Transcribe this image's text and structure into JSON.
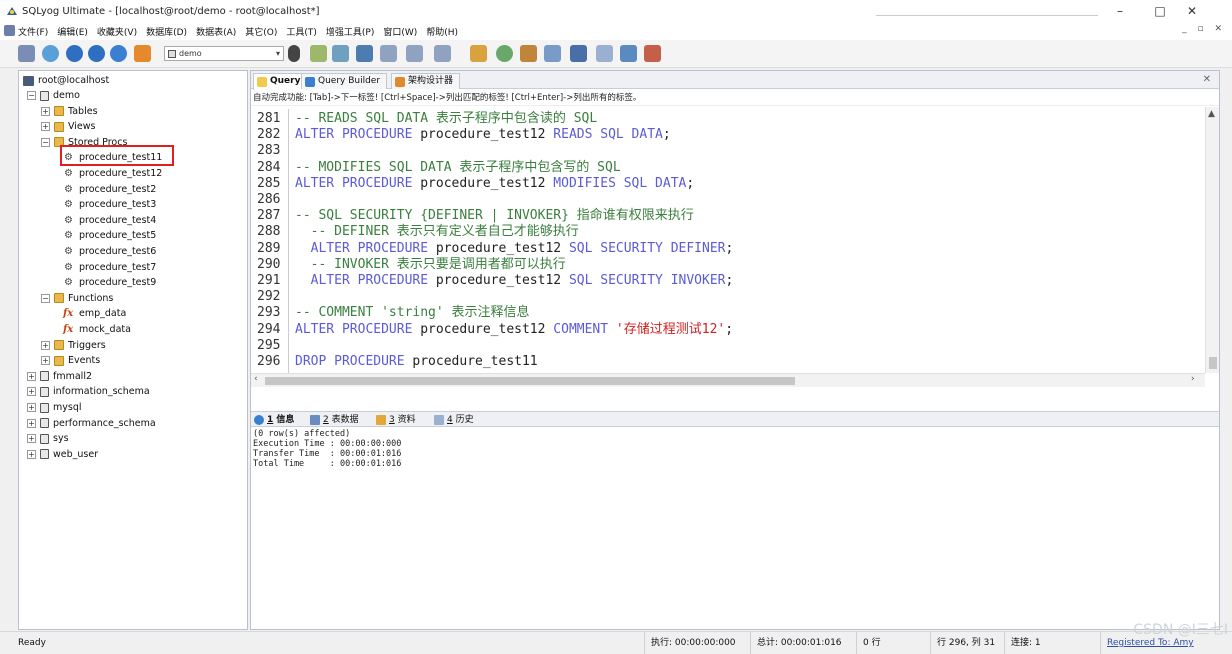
{
  "window": {
    "title": "SQLyog Ultimate - [localhost@root/demo - root@localhost*]",
    "min_glyph": "–",
    "max_glyph": "□",
    "close_glyph": "✕"
  },
  "menu": {
    "items": [
      "文件(F)",
      "编辑(E)",
      "收藏夹(V)",
      "数据库(D)",
      "数据表(A)",
      "其它(O)",
      "工具(T)",
      "增强工具(P)",
      "窗口(W)",
      "帮助(H)"
    ],
    "mdi_controls": "_ ▫ ✕"
  },
  "toolbar": {
    "db_select": "demo"
  },
  "object_browser": {
    "connection": "root@localhost",
    "tree": [
      {
        "level": 0,
        "kind": "db",
        "label": "demo",
        "expanded": true
      },
      {
        "level": 1,
        "kind": "folder",
        "label": "Tables",
        "expanded": false
      },
      {
        "level": 1,
        "kind": "folder",
        "label": "Views",
        "expanded": false
      },
      {
        "level": 1,
        "kind": "folder",
        "label": "Stored Procs",
        "expanded": true
      },
      {
        "level": 2,
        "kind": "proc",
        "label": "procedure_test11",
        "selected": true
      },
      {
        "level": 2,
        "kind": "proc",
        "label": "procedure_test12"
      },
      {
        "level": 2,
        "kind": "proc",
        "label": "procedure_test2"
      },
      {
        "level": 2,
        "kind": "proc",
        "label": "procedure_test3"
      },
      {
        "level": 2,
        "kind": "proc",
        "label": "procedure_test4"
      },
      {
        "level": 2,
        "kind": "proc",
        "label": "procedure_test5"
      },
      {
        "level": 2,
        "kind": "proc",
        "label": "procedure_test6"
      },
      {
        "level": 2,
        "kind": "proc",
        "label": "procedure_test7"
      },
      {
        "level": 2,
        "kind": "proc",
        "label": "procedure_test9"
      },
      {
        "level": 1,
        "kind": "folder",
        "label": "Functions",
        "expanded": true
      },
      {
        "level": 2,
        "kind": "func",
        "label": "emp_data"
      },
      {
        "level": 2,
        "kind": "func",
        "label": "mock_data"
      },
      {
        "level": 1,
        "kind": "folder",
        "label": "Triggers",
        "expanded": false
      },
      {
        "level": 1,
        "kind": "folder",
        "label": "Events",
        "expanded": false
      },
      {
        "level": 0,
        "kind": "db",
        "label": "fmmall2",
        "expanded": false
      },
      {
        "level": 0,
        "kind": "db",
        "label": "information_schema",
        "expanded": false
      },
      {
        "level": 0,
        "kind": "db",
        "label": "mysql",
        "expanded": false
      },
      {
        "level": 0,
        "kind": "db",
        "label": "performance_schema",
        "expanded": false
      },
      {
        "level": 0,
        "kind": "db",
        "label": "sys",
        "expanded": false
      },
      {
        "level": 0,
        "kind": "db",
        "label": "web_user",
        "expanded": false
      }
    ]
  },
  "tabs": [
    {
      "label": "Query",
      "active": true
    },
    {
      "label": "Query Builder",
      "active": false
    },
    {
      "label": "架构设计器",
      "active": false
    }
  ],
  "hint": "自动完成功能: [Tab]->下一标签! [Ctrl+Space]->列出匹配的标签! [Ctrl+Enter]->列出所有的标签。",
  "editor": {
    "lines": [
      {
        "no": "281",
        "tokens": [
          {
            "t": "-- READS SQL DATA 表示子程序中包含读的 SQL",
            "c": "comment"
          }
        ]
      },
      {
        "no": "282",
        "tokens": [
          {
            "t": "ALTER PROCEDURE ",
            "c": "kw"
          },
          {
            "t": "procedure_test12",
            "c": "id"
          },
          {
            "t": " READS SQL DATA",
            "c": "kw"
          },
          {
            "t": ";",
            "c": "punc"
          }
        ]
      },
      {
        "no": "283",
        "tokens": []
      },
      {
        "no": "284",
        "tokens": [
          {
            "t": "-- MODIFIES SQL DATA 表示子程序中包含写的 SQL",
            "c": "comment"
          }
        ]
      },
      {
        "no": "285",
        "tokens": [
          {
            "t": "ALTER PROCEDURE ",
            "c": "kw"
          },
          {
            "t": "procedure_test12",
            "c": "id"
          },
          {
            "t": " MODIFIES SQL DATA",
            "c": "kw"
          },
          {
            "t": ";",
            "c": "punc"
          }
        ]
      },
      {
        "no": "286",
        "tokens": []
      },
      {
        "no": "287",
        "tokens": [
          {
            "t": "-- SQL SECURITY {DEFINER | INVOKER} 指命谁有权限来执行",
            "c": "comment"
          }
        ]
      },
      {
        "no": "288",
        "tokens": [
          {
            "t": "  -- DEFINER 表示只有定义者自己才能够执行",
            "c": "comment"
          }
        ]
      },
      {
        "no": "289",
        "tokens": [
          {
            "t": "  ALTER PROCEDURE ",
            "c": "kw"
          },
          {
            "t": "procedure_test12",
            "c": "id"
          },
          {
            "t": " SQL SECURITY DEFINER",
            "c": "kw"
          },
          {
            "t": ";",
            "c": "punc"
          }
        ]
      },
      {
        "no": "290",
        "tokens": [
          {
            "t": "  -- INVOKER 表示只要是调用者都可以执行",
            "c": "comment"
          }
        ]
      },
      {
        "no": "291",
        "tokens": [
          {
            "t": "  ALTER PROCEDURE ",
            "c": "kw"
          },
          {
            "t": "procedure_test12",
            "c": "id"
          },
          {
            "t": " SQL SECURITY INVOKER",
            "c": "kw"
          },
          {
            "t": ";",
            "c": "punc"
          }
        ]
      },
      {
        "no": "292",
        "tokens": []
      },
      {
        "no": "293",
        "tokens": [
          {
            "t": "-- COMMENT 'string' 表示注释信息",
            "c": "comment"
          }
        ]
      },
      {
        "no": "294",
        "tokens": [
          {
            "t": "ALTER PROCEDURE ",
            "c": "kw"
          },
          {
            "t": "procedure_test12",
            "c": "id"
          },
          {
            "t": " COMMENT ",
            "c": "kw"
          },
          {
            "t": "'存储过程测试12'",
            "c": "str"
          },
          {
            "t": ";",
            "c": "punc"
          }
        ]
      },
      {
        "no": "295",
        "tokens": []
      },
      {
        "no": "296",
        "tokens": [
          {
            "t": "DROP PROCEDURE ",
            "c": "kw"
          },
          {
            "t": "procedure_test11",
            "c": "id"
          }
        ]
      }
    ]
  },
  "result_tabs": [
    {
      "num": "1",
      "label": "信息",
      "active": true
    },
    {
      "num": "2",
      "label": "表数据",
      "active": false
    },
    {
      "num": "3",
      "label": "资料",
      "active": false
    },
    {
      "num": "4",
      "label": "历史",
      "active": false
    }
  ],
  "messages": [
    "(0 row(s) affected)",
    "Execution Time : 00:00:00:000",
    "Transfer Time  : 00:00:01:016",
    "Total Time     : 00:00:01:016"
  ],
  "status": {
    "ready": "Ready",
    "exec": "执行: 00:00:00:000",
    "total": "总计: 00:00:01:016",
    "rows": "0 行",
    "position": "行 296, 列 31",
    "conn": "连接: 1",
    "registered": "Registered To: Amy"
  },
  "watermark": "CSDN @I三七I",
  "colors": {
    "comment": "#3a7f3e",
    "keyword": "#5b5bd6",
    "string": "#d02020",
    "selection_box": "#e02020"
  }
}
